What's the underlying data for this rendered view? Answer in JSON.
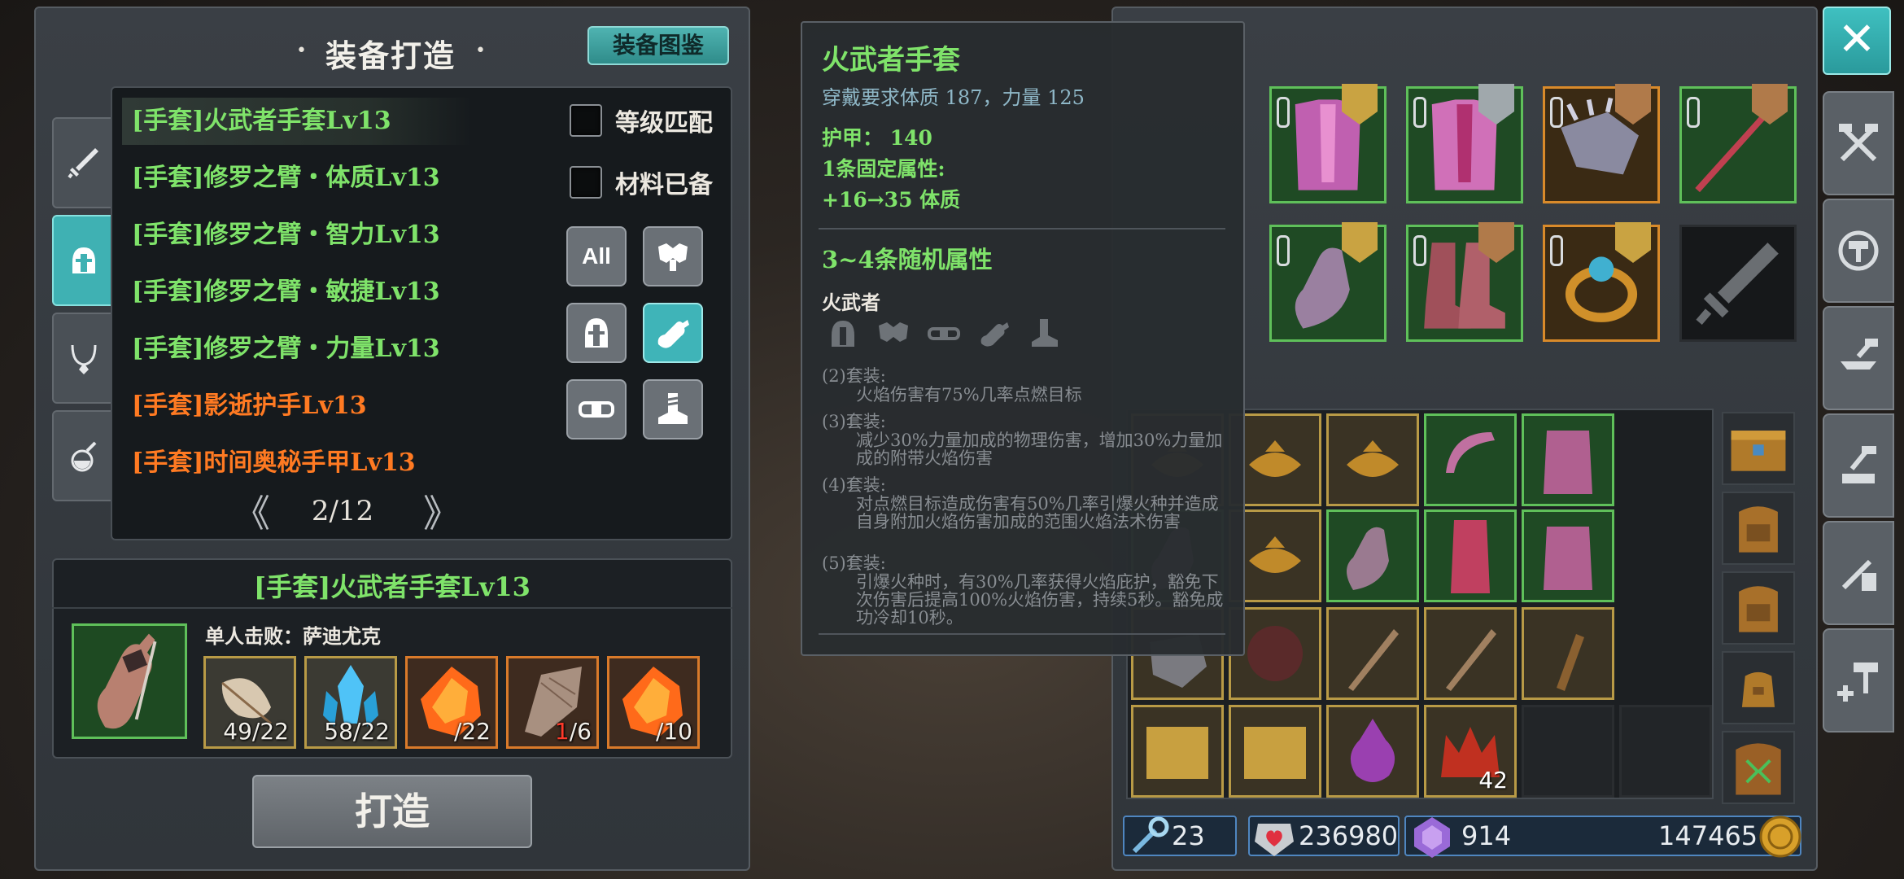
{
  "crafting": {
    "title": "装备打造",
    "codex_button": "装备图鉴",
    "recipes": [
      {
        "label": "[手套]火武者手套Lv13",
        "color": "green",
        "selected": true
      },
      {
        "label": "[手套]修罗之臂・体质Lv13",
        "color": "green"
      },
      {
        "label": "[手套]修罗之臂・智力Lv13",
        "color": "green"
      },
      {
        "label": "[手套]修罗之臂・敏捷Lv13",
        "color": "green"
      },
      {
        "label": "[手套]修罗之臂・力量Lv13",
        "color": "green"
      },
      {
        "label": "[手套]影逝护手Lv13",
        "color": "orange"
      },
      {
        "label": "[手套]时间奥秘手甲Lv13",
        "color": "orange"
      }
    ],
    "filters": {
      "level_match": "等级匹配",
      "materials_ready": "材料已备",
      "all_button": "All"
    },
    "pager": {
      "text": "2/12",
      "prev": "《",
      "next": "》"
    },
    "detail": {
      "title": "[手套]火武者手套Lv13",
      "defeat_label": "单人击败：萨迪尤克",
      "materials": [
        {
          "count": "49/22",
          "border": "gold"
        },
        {
          "count": "58/22",
          "border": "gold"
        },
        {
          "count_have": "",
          "count_need": "/22",
          "border": "orange"
        },
        {
          "count_have": "1",
          "count_need": "/6",
          "border": "orange"
        },
        {
          "count_have": "",
          "count_need": "/10",
          "border": "orange"
        }
      ]
    },
    "craft_button": "打造"
  },
  "tooltip": {
    "name": "火武者手套",
    "requirement": "穿戴要求体质 187，力量 125",
    "armor": "护甲：  140",
    "fixed_attr_header": "1条固定属性:",
    "fixed_attr": "+16→35  体质",
    "random_attr": "3~4条随机属性",
    "set_name": "火武者",
    "set_icons": [
      "helmet-icon",
      "shoulder-armor-icon",
      "belt-icon",
      "glove-icon",
      "boots-icon"
    ],
    "set_bonuses": [
      {
        "pieces": "(2)套装:",
        "text": "火焰伤害有75%几率点燃目标"
      },
      {
        "pieces": "(3)套装:",
        "text": "减少30%力量加成的物理伤害，增加30%力量加成的附带火焰伤害"
      },
      {
        "pieces": "(4)套装:",
        "text": "对点燃目标造成伤害有50%几率引爆火种并造成自身附加火焰伤害加成的范围火焰法术伤害"
      },
      {
        "pieces": "(5)套装:",
        "text": "引爆火种时，有30%几率获得火焰庇护，豁免下次伤害后提高100%火焰伤害，持续5秒。豁免成功冷却10秒。"
      }
    ]
  },
  "inventory": {
    "stack_count": "42",
    "currencies": {
      "keys": "23",
      "gems": "236980",
      "crystals": "914",
      "gold": "147465"
    }
  },
  "colors": {
    "accent_teal": "#3fb1b3",
    "rarity_green": "#7fe36a",
    "rarity_orange": "#ff7a22",
    "slot_gold": "#b89a46"
  }
}
